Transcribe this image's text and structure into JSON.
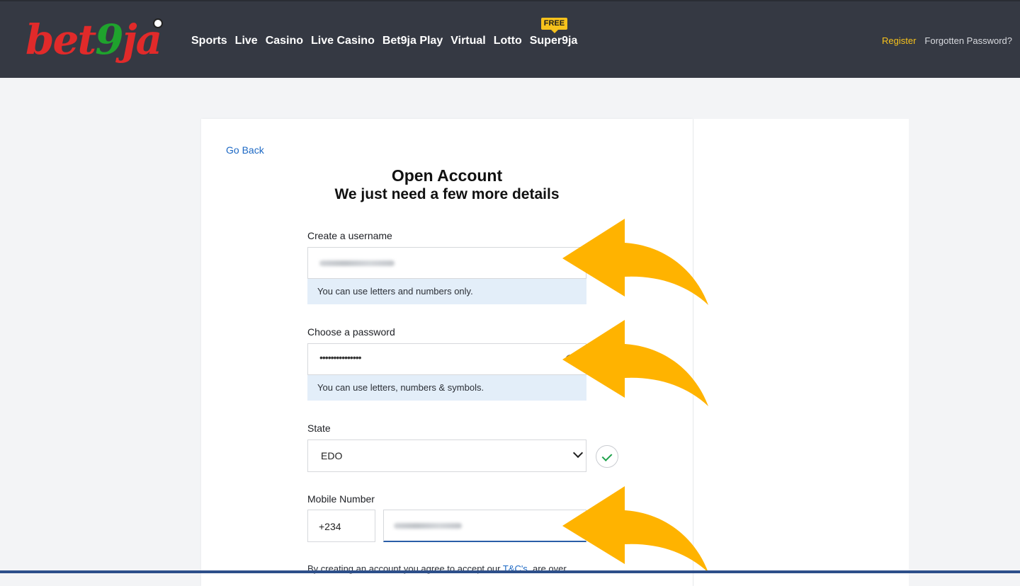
{
  "header": {
    "logo_text_a": "bet",
    "logo_text_b": "9",
    "logo_text_c": "ja",
    "nav": [
      "Sports",
      "Live",
      "Casino",
      "Live Casino",
      "Bet9ja Play",
      "Virtual",
      "Lotto",
      "Super9ja"
    ],
    "free_badge": "FREE",
    "register_label": "Register",
    "forgot_label": "Forgotten Password?"
  },
  "form": {
    "go_back": "Go Back",
    "title": "Open Account",
    "subtitle": "We just need a few more details",
    "username_label": "Create a username",
    "username_hint": "You can use letters and numbers only.",
    "password_label": "Choose a password",
    "password_value": "•••••••••••••••",
    "password_hint": "You can use letters, numbers & symbols.",
    "state_label": "State",
    "state_value": "EDO",
    "mobile_label": "Mobile Number",
    "mobile_prefix": "+234",
    "terms_text": "By creating an account you agree to accept our ",
    "terms_link": "T&C's",
    "terms_tail": ", are over"
  },
  "colors": {
    "header_bg": "#353943",
    "accent_yellow": "#f7c21c",
    "arrow": "#ffb300",
    "link_blue": "#1c68c4"
  }
}
